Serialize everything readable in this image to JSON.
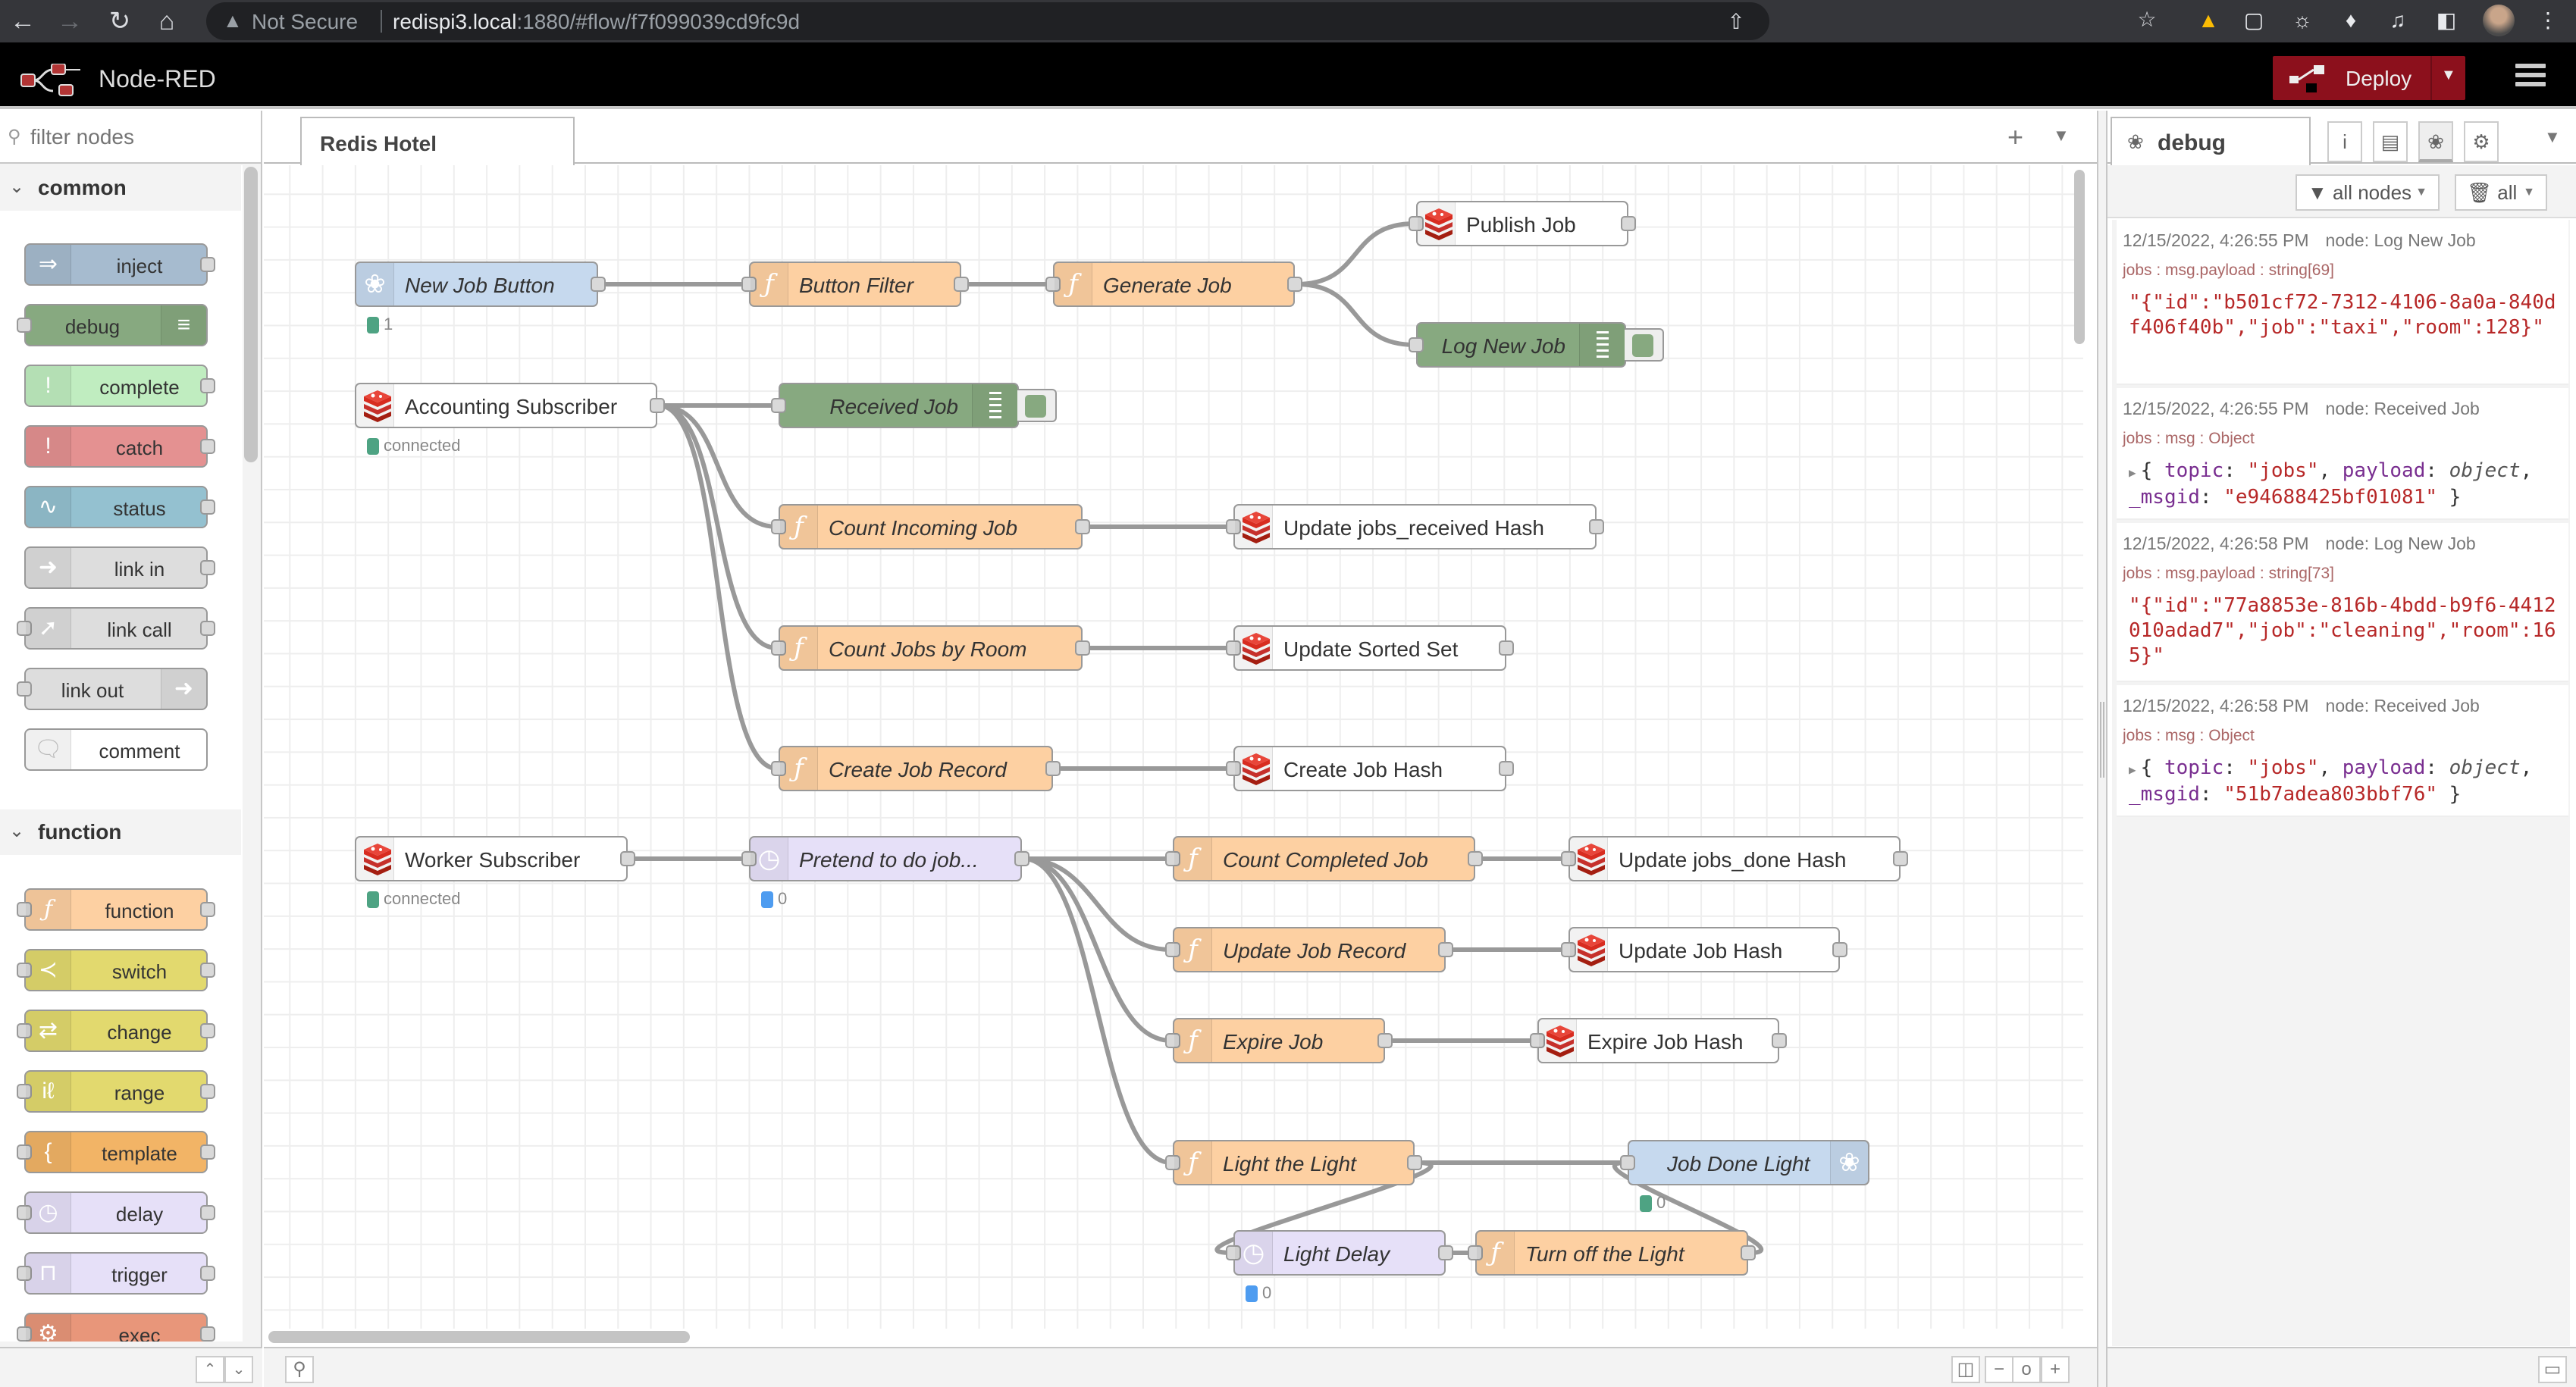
{
  "browser": {
    "security_label": "Not Secure",
    "url_host": "redispi3.local",
    "url_rest": ":1880/#flow/f7f099039cd9fc9d"
  },
  "app": {
    "title": "Node-RED",
    "deploy_label": "Deploy",
    "brand_color": "#8c101c"
  },
  "palette": {
    "search_placeholder": "filter nodes",
    "categories": [
      {
        "label": "common",
        "nodes": [
          {
            "label": "inject",
            "icon": "arrow-right-icon",
            "color": "#a6bbcf"
          },
          {
            "label": "debug",
            "icon": "list-icon",
            "color": "#87a980"
          },
          {
            "label": "complete",
            "icon": "exclamation-icon",
            "color": "#c0edc0"
          },
          {
            "label": "catch",
            "icon": "exclamation-icon",
            "color": "#e49191"
          },
          {
            "label": "status",
            "icon": "pulse-icon",
            "color": "#94c1d0"
          },
          {
            "label": "link in",
            "icon": "link-in-icon",
            "color": "#dddddd"
          },
          {
            "label": "link call",
            "icon": "link-call-icon",
            "color": "#dddddd"
          },
          {
            "label": "link out",
            "icon": "link-out-icon",
            "color": "#dddddd"
          },
          {
            "label": "comment",
            "icon": "speech-bubble-icon",
            "color": "#ffffff"
          }
        ]
      },
      {
        "label": "function",
        "nodes": [
          {
            "label": "function",
            "icon": "function-icon",
            "color": "#fdd0a2"
          },
          {
            "label": "switch",
            "icon": "switch-icon",
            "color": "#e2d96e"
          },
          {
            "label": "change",
            "icon": "shuffle-icon",
            "color": "#e2d96e"
          },
          {
            "label": "range",
            "icon": "range-icon",
            "color": "#e2d96e"
          },
          {
            "label": "template",
            "icon": "brace-icon",
            "color": "#f2b466"
          },
          {
            "label": "delay",
            "icon": "timer-icon",
            "color": "#e6e0f8"
          },
          {
            "label": "trigger",
            "icon": "trigger-icon",
            "color": "#e6e0f8"
          },
          {
            "label": "exec",
            "icon": "gear-icon",
            "color": "#e8967a"
          }
        ]
      }
    ]
  },
  "workspace": {
    "tab_label": "Redis Hotel",
    "nodes": [
      {
        "id": "n1",
        "label": "New Job Button",
        "type": "rpi-gpio-in",
        "status": {
          "color": "#4ea383",
          "text": "1"
        }
      },
      {
        "id": "n2",
        "label": "Button Filter",
        "type": "function"
      },
      {
        "id": "n3",
        "label": "Generate Job",
        "type": "function"
      },
      {
        "id": "n4",
        "label": "Publish Job",
        "type": "redis"
      },
      {
        "id": "n5",
        "label": "Log New Job",
        "type": "debug"
      },
      {
        "id": "n6",
        "label": "Accounting Subscriber",
        "type": "redis",
        "status": {
          "color": "#4ea383",
          "text": "connected"
        }
      },
      {
        "id": "n7",
        "label": "Received Job",
        "type": "debug"
      },
      {
        "id": "n8",
        "label": "Count Incoming Job",
        "type": "function"
      },
      {
        "id": "n9",
        "label": "Update jobs_received Hash",
        "type": "redis"
      },
      {
        "id": "n10",
        "label": "Count Jobs by Room",
        "type": "function"
      },
      {
        "id": "n11",
        "label": "Update Sorted Set",
        "type": "redis"
      },
      {
        "id": "n12",
        "label": "Create Job Record",
        "type": "function"
      },
      {
        "id": "n13",
        "label": "Create Job Hash",
        "type": "redis"
      },
      {
        "id": "n14",
        "label": "Worker Subscriber",
        "type": "redis",
        "status": {
          "color": "#4ea383",
          "text": "connected"
        }
      },
      {
        "id": "n15",
        "label": "Pretend to do job...",
        "type": "delay",
        "status": {
          "color": "#4e9cf0",
          "text": "0"
        }
      },
      {
        "id": "n16",
        "label": "Count Completed Job",
        "type": "function"
      },
      {
        "id": "n17",
        "label": "Update jobs_done Hash",
        "type": "redis"
      },
      {
        "id": "n18",
        "label": "Update Job Record",
        "type": "function"
      },
      {
        "id": "n19",
        "label": "Update Job Hash",
        "type": "redis"
      },
      {
        "id": "n20",
        "label": "Expire Job",
        "type": "function"
      },
      {
        "id": "n21",
        "label": "Expire Job Hash",
        "type": "redis"
      },
      {
        "id": "n22",
        "label": "Light the Light",
        "type": "function"
      },
      {
        "id": "n23",
        "label": "Job Done Light",
        "type": "rpi-gpio-out",
        "status": {
          "color": "#4ea383",
          "text": "0"
        }
      },
      {
        "id": "n24",
        "label": "Light Delay",
        "type": "delay",
        "status": {
          "color": "#4e9cf0",
          "text": "0"
        }
      },
      {
        "id": "n25",
        "label": "Turn off the Light",
        "type": "function"
      }
    ],
    "wires": [
      [
        "n1",
        "n2"
      ],
      [
        "n2",
        "n3"
      ],
      [
        "n3",
        "n4"
      ],
      [
        "n3",
        "n5"
      ],
      [
        "n6",
        "n7"
      ],
      [
        "n6",
        "n8"
      ],
      [
        "n6",
        "n10"
      ],
      [
        "n6",
        "n12"
      ],
      [
        "n8",
        "n9"
      ],
      [
        "n10",
        "n11"
      ],
      [
        "n12",
        "n13"
      ],
      [
        "n14",
        "n15"
      ],
      [
        "n15",
        "n16"
      ],
      [
        "n15",
        "n18"
      ],
      [
        "n15",
        "n20"
      ],
      [
        "n15",
        "n22"
      ],
      [
        "n16",
        "n17"
      ],
      [
        "n18",
        "n19"
      ],
      [
        "n20",
        "n21"
      ],
      [
        "n22",
        "n23"
      ],
      [
        "n22",
        "n24"
      ],
      [
        "n24",
        "n25"
      ],
      [
        "n25",
        "n23"
      ]
    ]
  },
  "sidebar": {
    "tab_label": "debug",
    "filter_label": "all nodes",
    "clear_label": "all",
    "messages": [
      {
        "time": "12/15/2022, 4:26:55 PM",
        "node": "node: Log New Job",
        "path": "jobs : msg.payload : string[69]",
        "value": "\"{\"id\":\"b501cf72-7312-4106-8a0a-840df406f40b\",\"job\":\"taxi\",\"room\":128}\""
      },
      {
        "time": "12/15/2022, 4:26:55 PM",
        "node": "node: Received Job",
        "path": "jobs : msg : Object",
        "object": {
          "topic": "\"jobs\"",
          "payload": "object",
          "_msgid": "\"e94688425bf01081\""
        }
      },
      {
        "time": "12/15/2022, 4:26:58 PM",
        "node": "node: Log New Job",
        "path": "jobs : msg.payload : string[73]",
        "value": "\"{\"id\":\"77a8853e-816b-4bdd-b9f6-4412010adad7\",\"job\":\"cleaning\",\"room\":165}\""
      },
      {
        "time": "12/15/2022, 4:26:58 PM",
        "node": "node: Received Job",
        "path": "jobs : msg : Object",
        "object": {
          "topic": "\"jobs\"",
          "payload": "object",
          "_msgid": "\"51b7adea803bbf76\""
        }
      }
    ]
  }
}
